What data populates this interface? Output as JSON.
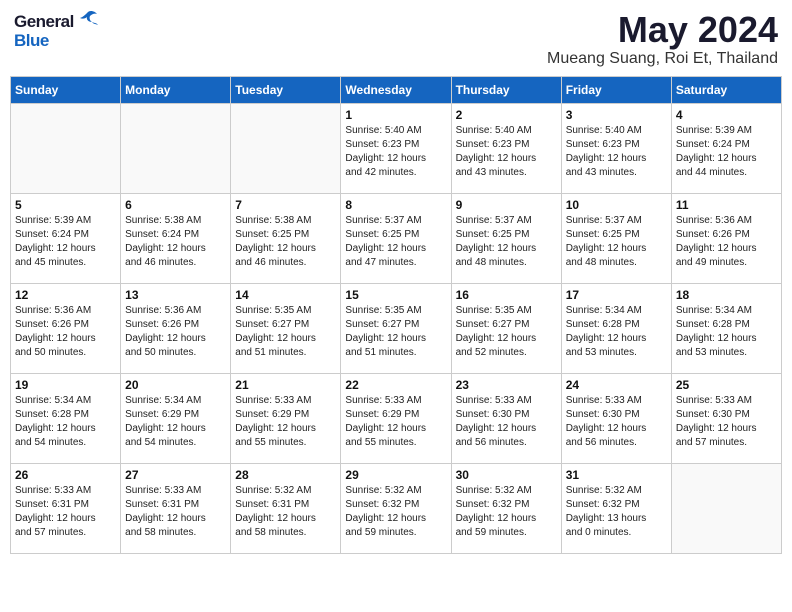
{
  "logo": {
    "text_general": "General",
    "text_blue": "Blue"
  },
  "header": {
    "month_year": "May 2024",
    "location": "Mueang Suang, Roi Et, Thailand"
  },
  "weekdays": [
    "Sunday",
    "Monday",
    "Tuesday",
    "Wednesday",
    "Thursday",
    "Friday",
    "Saturday"
  ],
  "weeks": [
    [
      {
        "day": "",
        "info": ""
      },
      {
        "day": "",
        "info": ""
      },
      {
        "day": "",
        "info": ""
      },
      {
        "day": "1",
        "info": "Sunrise: 5:40 AM\nSunset: 6:23 PM\nDaylight: 12 hours\nand 42 minutes."
      },
      {
        "day": "2",
        "info": "Sunrise: 5:40 AM\nSunset: 6:23 PM\nDaylight: 12 hours\nand 43 minutes."
      },
      {
        "day": "3",
        "info": "Sunrise: 5:40 AM\nSunset: 6:23 PM\nDaylight: 12 hours\nand 43 minutes."
      },
      {
        "day": "4",
        "info": "Sunrise: 5:39 AM\nSunset: 6:24 PM\nDaylight: 12 hours\nand 44 minutes."
      }
    ],
    [
      {
        "day": "5",
        "info": "Sunrise: 5:39 AM\nSunset: 6:24 PM\nDaylight: 12 hours\nand 45 minutes."
      },
      {
        "day": "6",
        "info": "Sunrise: 5:38 AM\nSunset: 6:24 PM\nDaylight: 12 hours\nand 46 minutes."
      },
      {
        "day": "7",
        "info": "Sunrise: 5:38 AM\nSunset: 6:25 PM\nDaylight: 12 hours\nand 46 minutes."
      },
      {
        "day": "8",
        "info": "Sunrise: 5:37 AM\nSunset: 6:25 PM\nDaylight: 12 hours\nand 47 minutes."
      },
      {
        "day": "9",
        "info": "Sunrise: 5:37 AM\nSunset: 6:25 PM\nDaylight: 12 hours\nand 48 minutes."
      },
      {
        "day": "10",
        "info": "Sunrise: 5:37 AM\nSunset: 6:25 PM\nDaylight: 12 hours\nand 48 minutes."
      },
      {
        "day": "11",
        "info": "Sunrise: 5:36 AM\nSunset: 6:26 PM\nDaylight: 12 hours\nand 49 minutes."
      }
    ],
    [
      {
        "day": "12",
        "info": "Sunrise: 5:36 AM\nSunset: 6:26 PM\nDaylight: 12 hours\nand 50 minutes."
      },
      {
        "day": "13",
        "info": "Sunrise: 5:36 AM\nSunset: 6:26 PM\nDaylight: 12 hours\nand 50 minutes."
      },
      {
        "day": "14",
        "info": "Sunrise: 5:35 AM\nSunset: 6:27 PM\nDaylight: 12 hours\nand 51 minutes."
      },
      {
        "day": "15",
        "info": "Sunrise: 5:35 AM\nSunset: 6:27 PM\nDaylight: 12 hours\nand 51 minutes."
      },
      {
        "day": "16",
        "info": "Sunrise: 5:35 AM\nSunset: 6:27 PM\nDaylight: 12 hours\nand 52 minutes."
      },
      {
        "day": "17",
        "info": "Sunrise: 5:34 AM\nSunset: 6:28 PM\nDaylight: 12 hours\nand 53 minutes."
      },
      {
        "day": "18",
        "info": "Sunrise: 5:34 AM\nSunset: 6:28 PM\nDaylight: 12 hours\nand 53 minutes."
      }
    ],
    [
      {
        "day": "19",
        "info": "Sunrise: 5:34 AM\nSunset: 6:28 PM\nDaylight: 12 hours\nand 54 minutes."
      },
      {
        "day": "20",
        "info": "Sunrise: 5:34 AM\nSunset: 6:29 PM\nDaylight: 12 hours\nand 54 minutes."
      },
      {
        "day": "21",
        "info": "Sunrise: 5:33 AM\nSunset: 6:29 PM\nDaylight: 12 hours\nand 55 minutes."
      },
      {
        "day": "22",
        "info": "Sunrise: 5:33 AM\nSunset: 6:29 PM\nDaylight: 12 hours\nand 55 minutes."
      },
      {
        "day": "23",
        "info": "Sunrise: 5:33 AM\nSunset: 6:30 PM\nDaylight: 12 hours\nand 56 minutes."
      },
      {
        "day": "24",
        "info": "Sunrise: 5:33 AM\nSunset: 6:30 PM\nDaylight: 12 hours\nand 56 minutes."
      },
      {
        "day": "25",
        "info": "Sunrise: 5:33 AM\nSunset: 6:30 PM\nDaylight: 12 hours\nand 57 minutes."
      }
    ],
    [
      {
        "day": "26",
        "info": "Sunrise: 5:33 AM\nSunset: 6:31 PM\nDaylight: 12 hours\nand 57 minutes."
      },
      {
        "day": "27",
        "info": "Sunrise: 5:33 AM\nSunset: 6:31 PM\nDaylight: 12 hours\nand 58 minutes."
      },
      {
        "day": "28",
        "info": "Sunrise: 5:32 AM\nSunset: 6:31 PM\nDaylight: 12 hours\nand 58 minutes."
      },
      {
        "day": "29",
        "info": "Sunrise: 5:32 AM\nSunset: 6:32 PM\nDaylight: 12 hours\nand 59 minutes."
      },
      {
        "day": "30",
        "info": "Sunrise: 5:32 AM\nSunset: 6:32 PM\nDaylight: 12 hours\nand 59 minutes."
      },
      {
        "day": "31",
        "info": "Sunrise: 5:32 AM\nSunset: 6:32 PM\nDaylight: 13 hours\nand 0 minutes."
      },
      {
        "day": "",
        "info": ""
      }
    ]
  ]
}
